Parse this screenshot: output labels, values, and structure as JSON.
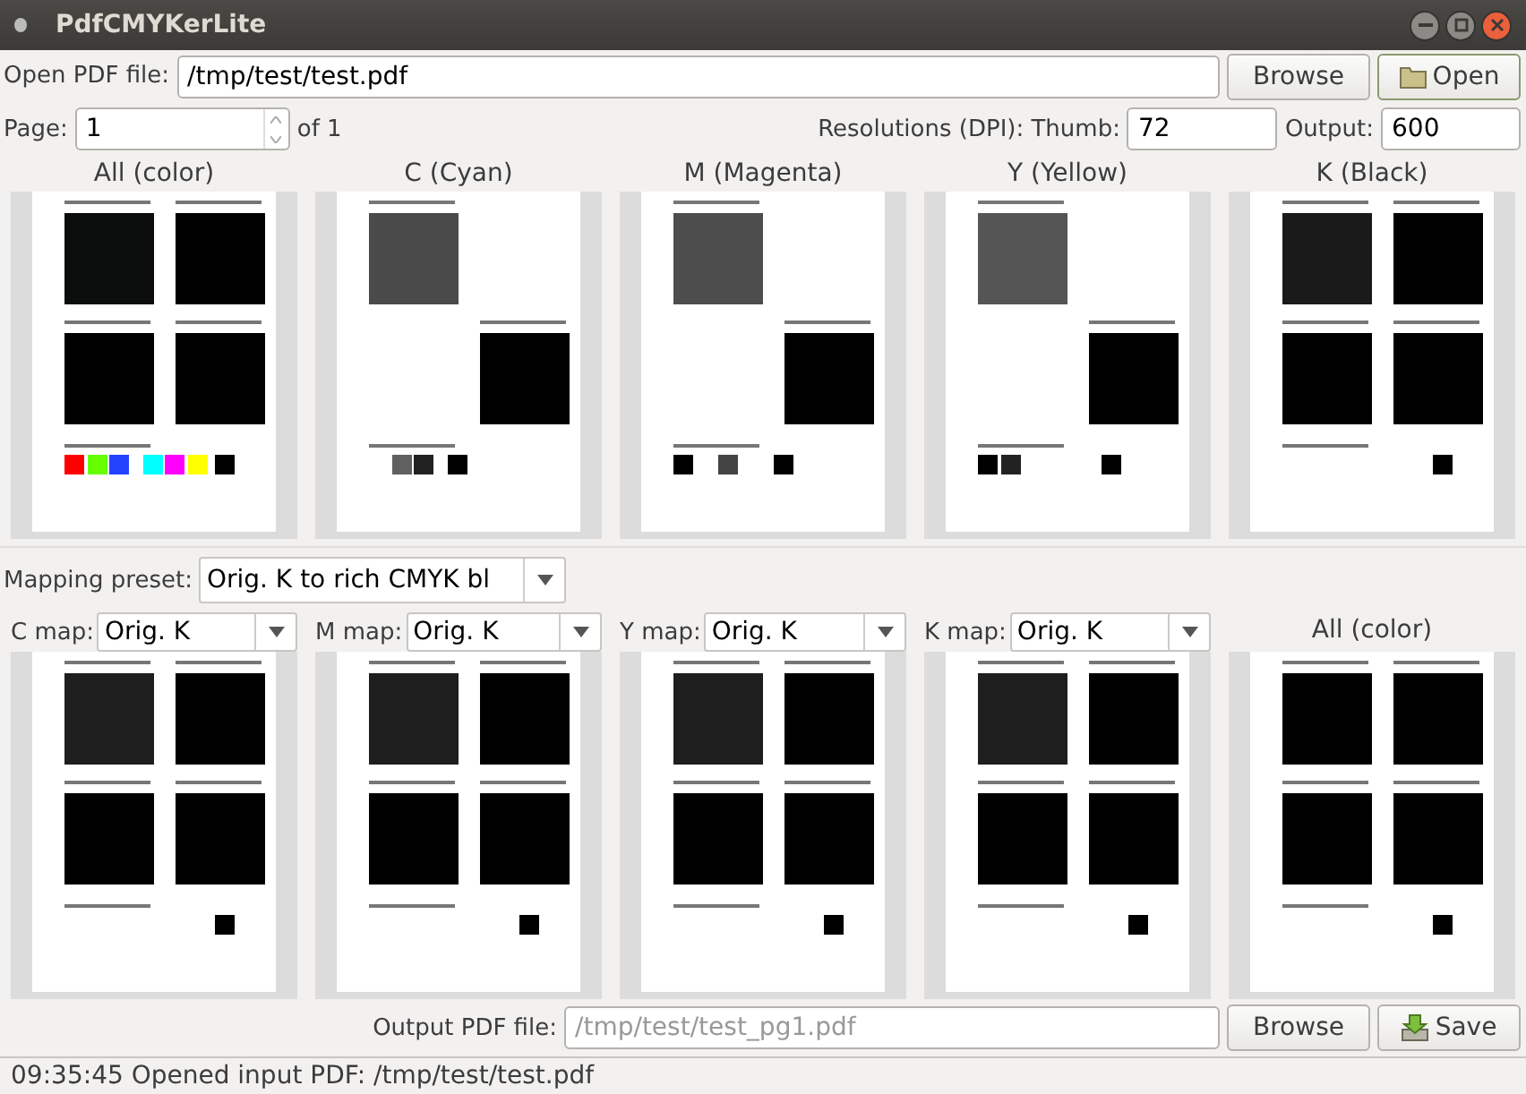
{
  "window": {
    "title": "PdfCMYKerLite"
  },
  "open_file": {
    "label": "Open PDF file:",
    "value": "/tmp/test/test.pdf",
    "browse": "Browse",
    "open": "Open"
  },
  "page": {
    "label": "Page:",
    "value": "1",
    "of": "of 1"
  },
  "resolutions": {
    "label": "Resolutions (DPI): Thumb:",
    "thumb": "72",
    "output_label": "Output:",
    "output": "600"
  },
  "top_previews": [
    {
      "label": "All (color)",
      "squares": [
        {
          "kind": "topleft",
          "color": "#0b0d0d"
        },
        {
          "kind": "topright",
          "color": "#000000"
        },
        {
          "kind": "bottomleft",
          "color": "#000000"
        },
        {
          "kind": "bottomright",
          "color": "#000000"
        }
      ],
      "swatches": [
        {
          "kind": "first",
          "color": "#ff0000"
        },
        {
          "kind": "second",
          "color": "#66ff00"
        },
        {
          "kind": "third",
          "color": "#2244ff"
        },
        {
          "kind": "fourth",
          "color": "#00ffff"
        },
        {
          "kind": "fifth",
          "color": "#ff00ff"
        },
        {
          "kind": "sixth",
          "color": "#ffff00"
        },
        {
          "kind": "seventh",
          "color": "#000000"
        }
      ]
    },
    {
      "label": "C (Cyan)",
      "squares": [
        {
          "kind": "topleft",
          "color": "#4a4a4a"
        },
        {
          "kind": "bottomright",
          "color": "#000000"
        }
      ],
      "swatches": [
        {
          "kind": "second",
          "color": "#606060"
        },
        {
          "kind": "third",
          "color": "#222222"
        },
        {
          "kind": "fourth",
          "color": "#000000"
        }
      ]
    },
    {
      "label": "M (Magenta)",
      "squares": [
        {
          "kind": "topleft",
          "color": "#4d4d4d"
        },
        {
          "kind": "bottomright",
          "color": "#000000"
        }
      ],
      "swatches": [
        {
          "kind": "first",
          "color": "#000000"
        },
        {
          "kind": "third",
          "color": "#444444"
        },
        {
          "kind": "fifth",
          "color": "#000000"
        }
      ]
    },
    {
      "label": "Y (Yellow)",
      "squares": [
        {
          "kind": "topleft",
          "color": "#555555"
        },
        {
          "kind": "bottomright",
          "color": "#000000"
        }
      ],
      "swatches": [
        {
          "kind": "first",
          "color": "#000000"
        },
        {
          "kind": "second",
          "color": "#222222"
        },
        {
          "kind": "sixth",
          "color": "#000000"
        }
      ]
    },
    {
      "label": "K (Black)",
      "squares": [
        {
          "kind": "topleft",
          "color": "#1a1a1a"
        },
        {
          "kind": "topright",
          "color": "#000000"
        },
        {
          "kind": "bottomleft",
          "color": "#000000"
        },
        {
          "kind": "bottomright",
          "color": "#000000"
        }
      ],
      "swatches": [
        {
          "kind": "seventh",
          "color": "#000000"
        }
      ]
    }
  ],
  "mapping_preset": {
    "label": "Mapping preset:",
    "value": "Orig. K to rich CMYK bl"
  },
  "maps": [
    {
      "label": "C map:",
      "value": "Orig. K",
      "squares": [
        {
          "kind": "topleft",
          "color": "#1e1e1e"
        },
        {
          "kind": "topright",
          "color": "#000000"
        },
        {
          "kind": "bottomleft",
          "color": "#000000"
        },
        {
          "kind": "bottomright",
          "color": "#000000"
        }
      ],
      "swatches": [
        {
          "kind": "seventh",
          "color": "#000000"
        }
      ]
    },
    {
      "label": "M map:",
      "value": "Orig. K",
      "squares": [
        {
          "kind": "topleft",
          "color": "#1e1e1e"
        },
        {
          "kind": "topright",
          "color": "#000000"
        },
        {
          "kind": "bottomleft",
          "color": "#000000"
        },
        {
          "kind": "bottomright",
          "color": "#000000"
        }
      ],
      "swatches": [
        {
          "kind": "seventh",
          "color": "#000000"
        }
      ]
    },
    {
      "label": "Y map:",
      "value": "Orig. K",
      "squares": [
        {
          "kind": "topleft",
          "color": "#1e1e1e"
        },
        {
          "kind": "topright",
          "color": "#000000"
        },
        {
          "kind": "bottomleft",
          "color": "#000000"
        },
        {
          "kind": "bottomright",
          "color": "#000000"
        }
      ],
      "swatches": [
        {
          "kind": "seventh",
          "color": "#000000"
        }
      ]
    },
    {
      "label": "K map:",
      "value": "Orig. K",
      "squares": [
        {
          "kind": "topleft",
          "color": "#1e1e1e"
        },
        {
          "kind": "topright",
          "color": "#000000"
        },
        {
          "kind": "bottomleft",
          "color": "#000000"
        },
        {
          "kind": "bottomright",
          "color": "#000000"
        }
      ],
      "swatches": [
        {
          "kind": "seventh",
          "color": "#000000"
        }
      ]
    }
  ],
  "result_preview": {
    "label": "All (color)",
    "squares": [
      {
        "kind": "topleft",
        "color": "#000000"
      },
      {
        "kind": "topright",
        "color": "#000000"
      },
      {
        "kind": "bottomleft",
        "color": "#000000"
      },
      {
        "kind": "bottomright",
        "color": "#000000"
      }
    ],
    "swatches": [
      {
        "kind": "seventh",
        "color": "#000000"
      }
    ]
  },
  "output_file": {
    "label": "Output PDF file:",
    "placeholder": "/tmp/test/test_pg1.pdf",
    "browse": "Browse",
    "save": "Save"
  },
  "status_bar": {
    "text": "09:35:45 Opened input PDF: /tmp/test/test.pdf"
  }
}
